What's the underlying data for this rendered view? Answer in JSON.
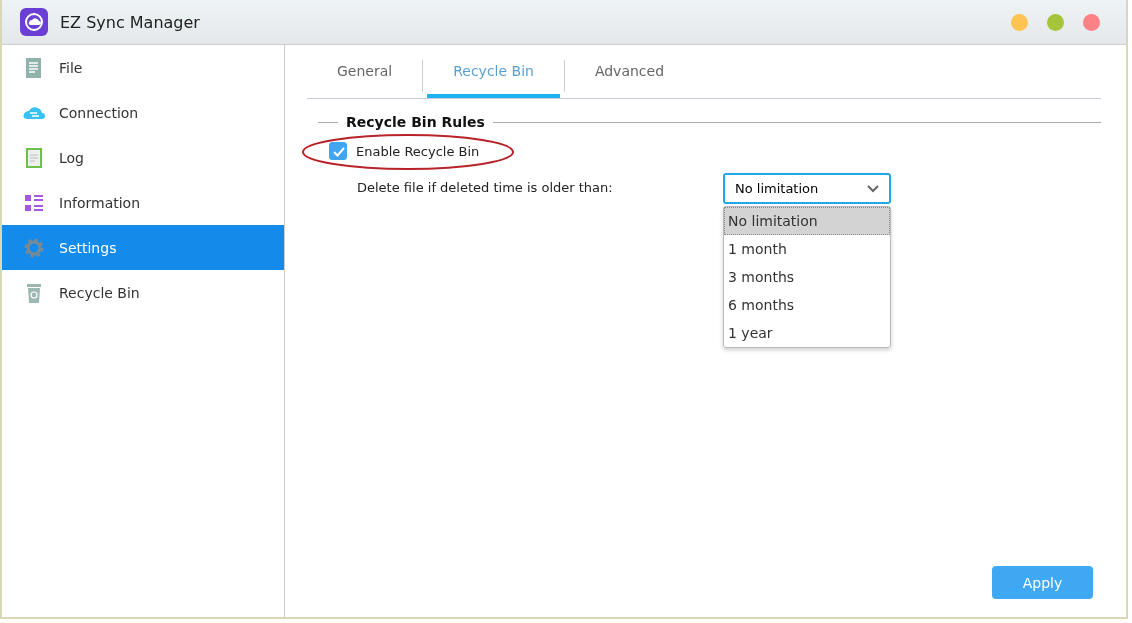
{
  "window": {
    "title": "EZ Sync Manager",
    "controls": [
      {
        "color": "#fdc453"
      },
      {
        "color": "#a5c43a"
      },
      {
        "color": "#fd8185"
      }
    ]
  },
  "sidebar": {
    "items": [
      {
        "label": "File",
        "kind": "file",
        "selected": false
      },
      {
        "label": "Connection",
        "kind": "cloud",
        "selected": false
      },
      {
        "label": "Log",
        "kind": "log",
        "selected": false
      },
      {
        "label": "Information",
        "kind": "list",
        "selected": false
      },
      {
        "label": "Settings",
        "kind": "gear",
        "selected": true
      },
      {
        "label": "Recycle Bin",
        "kind": "bin",
        "selected": false
      }
    ]
  },
  "tabs": [
    {
      "label": "General",
      "selected": false
    },
    {
      "label": "Recycle Bin",
      "selected": true
    },
    {
      "label": "Advanced",
      "selected": false
    }
  ],
  "section": {
    "title": "Recycle Bin Rules",
    "enable": {
      "label": "Enable Recycle Bin",
      "checked": true,
      "circled": true
    },
    "delete_label": "Delete file if deleted time is older than:",
    "dropdown": {
      "value": "No limitation",
      "expanded": true,
      "options": [
        {
          "label": "No limitation",
          "selected": true
        },
        {
          "label": "1 month",
          "selected": false
        },
        {
          "label": "3 months",
          "selected": false
        },
        {
          "label": "6 months",
          "selected": false
        },
        {
          "label": "1 year",
          "selected": false
        }
      ]
    }
  },
  "apply_button": "Apply"
}
